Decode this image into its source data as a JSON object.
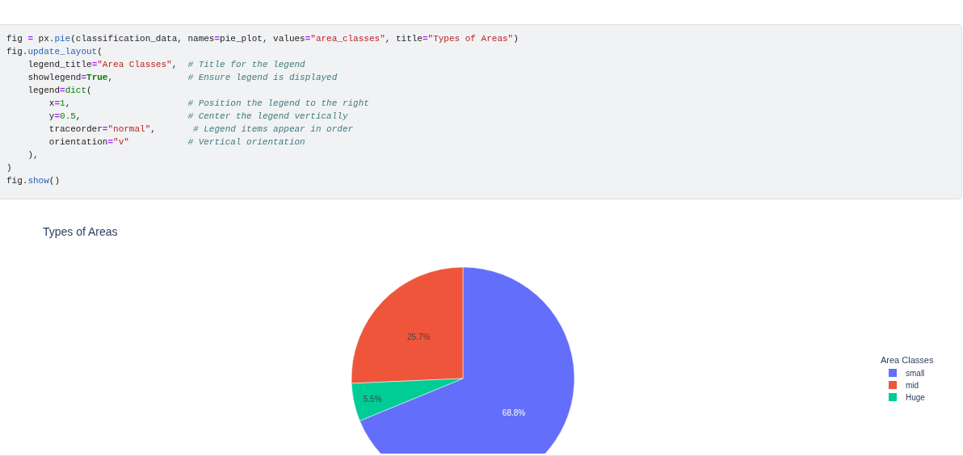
{
  "code": {
    "lines": [
      [
        {
          "kind": "plain",
          "text": "fig "
        },
        {
          "kind": "op",
          "text": "="
        },
        {
          "kind": "plain",
          "text": " px."
        },
        {
          "kind": "fn",
          "text": "pie"
        },
        {
          "kind": "plain",
          "text": "(classification_data, names"
        },
        {
          "kind": "op",
          "text": "="
        },
        {
          "kind": "plain",
          "text": "pie_plot, values"
        },
        {
          "kind": "op",
          "text": "="
        },
        {
          "kind": "str",
          "text": "\"area_classes\""
        },
        {
          "kind": "plain",
          "text": ", title"
        },
        {
          "kind": "op",
          "text": "="
        },
        {
          "kind": "str",
          "text": "\"Types of Areas\""
        },
        {
          "kind": "plain",
          "text": ")"
        }
      ],
      [
        {
          "kind": "plain",
          "text": "fig."
        },
        {
          "kind": "fn",
          "text": "update_layout"
        },
        {
          "kind": "plain",
          "text": "("
        }
      ],
      [
        {
          "kind": "plain",
          "text": "    legend_title"
        },
        {
          "kind": "op",
          "text": "="
        },
        {
          "kind": "str",
          "text": "\"Area Classes\""
        },
        {
          "kind": "plain",
          "text": ",  "
        },
        {
          "kind": "comment",
          "text": "# Title for the legend"
        }
      ],
      [
        {
          "kind": "plain",
          "text": "    showlegend"
        },
        {
          "kind": "op",
          "text": "="
        },
        {
          "kind": "kw",
          "text": "True"
        },
        {
          "kind": "plain",
          "text": ",              "
        },
        {
          "kind": "comment",
          "text": "# Ensure legend is displayed"
        }
      ],
      [
        {
          "kind": "plain",
          "text": "    legend"
        },
        {
          "kind": "op",
          "text": "="
        },
        {
          "kind": "builtin",
          "text": "dict"
        },
        {
          "kind": "plain",
          "text": "("
        }
      ],
      [
        {
          "kind": "plain",
          "text": "        x"
        },
        {
          "kind": "op",
          "text": "="
        },
        {
          "kind": "num",
          "text": "1"
        },
        {
          "kind": "plain",
          "text": ",                      "
        },
        {
          "kind": "comment",
          "text": "# Position the legend to the right"
        }
      ],
      [
        {
          "kind": "plain",
          "text": "        y"
        },
        {
          "kind": "op",
          "text": "="
        },
        {
          "kind": "num",
          "text": "0.5"
        },
        {
          "kind": "plain",
          "text": ",                    "
        },
        {
          "kind": "comment",
          "text": "# Center the legend vertically"
        }
      ],
      [
        {
          "kind": "plain",
          "text": "        traceorder"
        },
        {
          "kind": "op",
          "text": "="
        },
        {
          "kind": "str",
          "text": "\"normal\""
        },
        {
          "kind": "plain",
          "text": ",       "
        },
        {
          "kind": "comment",
          "text": "# Legend items appear in order"
        }
      ],
      [
        {
          "kind": "plain",
          "text": "        orientation"
        },
        {
          "kind": "op",
          "text": "="
        },
        {
          "kind": "str",
          "text": "\"v\""
        },
        {
          "kind": "comment",
          "text": "           # Vertical orientation"
        }
      ],
      [
        {
          "kind": "plain",
          "text": "    ),"
        }
      ],
      [
        {
          "kind": "plain",
          "text": ")"
        }
      ],
      [
        {
          "kind": "plain",
          "text": "fig."
        },
        {
          "kind": "fn",
          "text": "show"
        },
        {
          "kind": "plain",
          "text": "()"
        }
      ]
    ]
  },
  "figure": {
    "chart_data": {
      "type": "pie",
      "title": "Types of Areas",
      "legend": {
        "title": "Area Classes"
      },
      "categories": [
        "small",
        "mid",
        "Huge"
      ],
      "series": [
        {
          "colors": [
            "#636efa",
            "#ef553b",
            "#00cc96"
          ],
          "values": [
            68.8,
            25.7,
            5.5
          ]
        }
      ],
      "value_labels": [
        "68.8%",
        "25.7%",
        "5.5%"
      ]
    }
  }
}
